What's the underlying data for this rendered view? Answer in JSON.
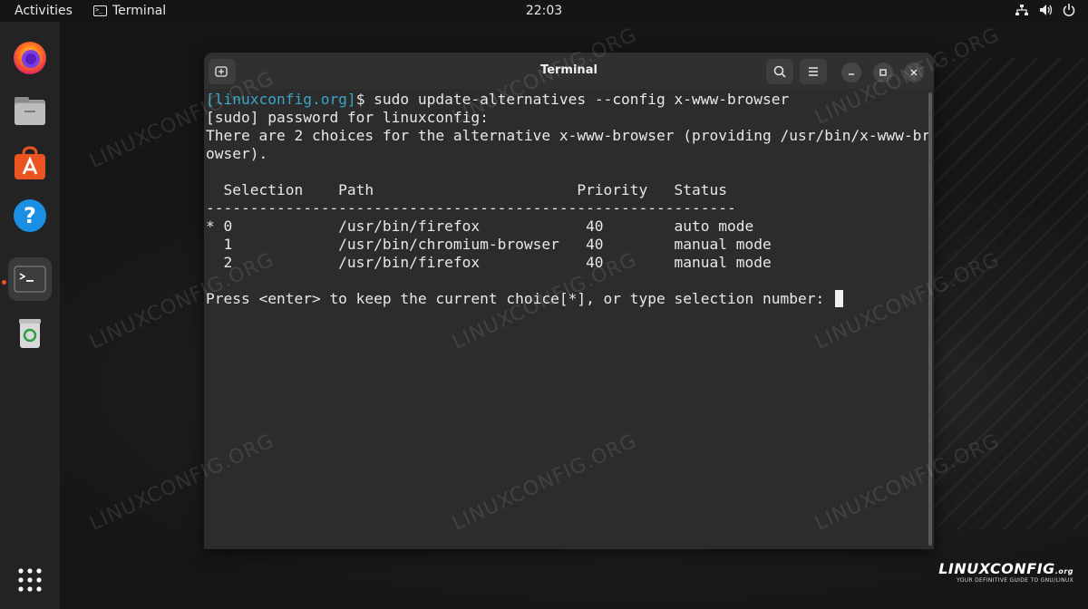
{
  "topbar": {
    "activities": "Activities",
    "app_name": "Terminal",
    "clock": "22:03"
  },
  "dock": {
    "items": [
      {
        "name": "firefox"
      },
      {
        "name": "files"
      },
      {
        "name": "app-center"
      },
      {
        "name": "help"
      },
      {
        "name": "terminal",
        "active": true
      },
      {
        "name": "trash"
      },
      {
        "name": "show-apps"
      }
    ]
  },
  "terminal": {
    "title": "Terminal",
    "lines": {
      "l1_prompt": "[linuxconfig.org]",
      "l1_cmd": "$ sudo update-alternatives --config x-www-browser",
      "l2": "[sudo] password for linuxconfig:",
      "l3": "There are 2 choices for the alternative x-www-browser (providing /usr/bin/x-www-br",
      "l4": "owser).",
      "l5": "",
      "l6": "  Selection    Path                       Priority   Status",
      "l7": "------------------------------------------------------------",
      "l8": "* 0            /usr/bin/firefox            40        auto mode",
      "l9": "  1            /usr/bin/chromium-browser   40        manual mode",
      "l10": "  2            /usr/bin/firefox            40        manual mode",
      "l11": "",
      "l12": "Press <enter> to keep the current choice[*], or type selection number: "
    }
  },
  "watermark": "LINUXCONFIG.ORG",
  "logo": {
    "name": "LINUXCONFIG",
    "suffix": ".org",
    "tagline": "YOUR DEFINITIVE GUIDE TO GNU/LINUX"
  },
  "colors": {
    "prompt": "#3aa5c8",
    "accent": "#e95420"
  }
}
